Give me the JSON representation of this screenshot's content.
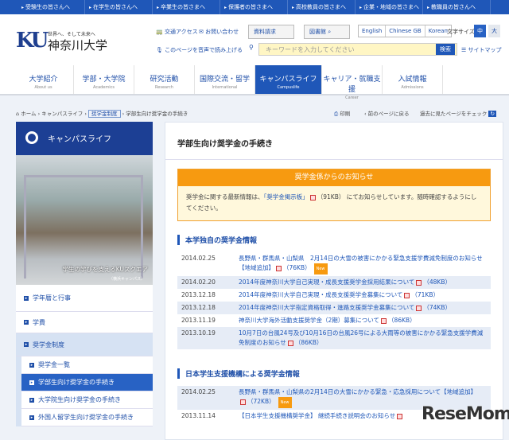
{
  "topbar": [
    "受験生の皆さんへ",
    "在学生の皆さんへ",
    "卒業生の皆さまへ",
    "保護者の皆さまへ",
    "高校教員の皆さまへ",
    "企業・地域の皆さまへ",
    "教職員の皆さんへ"
  ],
  "header": {
    "logo": "KU",
    "tagline": "世界へ、そして未来へ",
    "name": "神奈川大学",
    "access": "交通アクセス",
    "contact": "お問い合わせ",
    "request": "資料請求",
    "library": "図書館",
    "voice": "このページを音声で読み上げる",
    "langs": [
      "English",
      "Chinese GB",
      "Korean"
    ],
    "font_size_label": "文字サイズ",
    "font_mid": "中",
    "font_large": "大",
    "search_placeholder": "キーワードを入力してください",
    "search_button": "検索",
    "sitemap": "サイトマップ"
  },
  "nav": [
    {
      "jp": "大学紹介",
      "en": "About us"
    },
    {
      "jp": "学部・大学院",
      "en": "Academics"
    },
    {
      "jp": "研究活動",
      "en": "Research"
    },
    {
      "jp": "国際交流・留学",
      "en": "International"
    },
    {
      "jp": "キャンパスライフ",
      "en": "Campuslife"
    },
    {
      "jp": "キャリア・就職支援",
      "en": "Career"
    },
    {
      "jp": "入試情報",
      "en": "Admissions"
    }
  ],
  "breadcrumb": {
    "home": "ホーム",
    "b1": "キャンパスライフ",
    "b2": "奨学金制度",
    "current": "学部生向け奨学金の手続き"
  },
  "util": {
    "print": "印刷",
    "back": "前のページに戻る",
    "history": "過去に見たページをチェック"
  },
  "sidebar": {
    "title": "キャンパスライフ",
    "photo_caption": "学生の学びを支えるKUスクエア",
    "photo_sub": "（横浜キャンパス）",
    "items": [
      "学年暦と行事",
      "学費",
      "奨学金制度"
    ],
    "subitems": [
      "奨学金一覧",
      "学部生向け奨学金の手続き",
      "大学院生向け奨学金の手続き",
      "外国人留学生向け奨学金の手続き"
    ]
  },
  "main": {
    "title": "学部生向け奨学金の手続き",
    "notice": {
      "heading": "奨学金係からのお知らせ",
      "pre": "奨学金に関する最新情報は、",
      "link": "「奨学金掲示板」",
      "size": "（91KB）",
      "post": "にてお知らせしています。随時確認するようにしてください。"
    },
    "section1": "本学独自の奨学金情報",
    "rows1": [
      {
        "date": "2014.02.25",
        "text": "長野県・群馬県・山梨県　2月14日の大雪の被害にかかる緊急支援学費減免制度のお知らせ【地域追加】",
        "size": "（76KB）",
        "new": "New"
      },
      {
        "date": "2014.02.20",
        "text": "2014年度神奈川大学自己実現・成長支援奨学金採用結果について",
        "size": "（48KB）"
      },
      {
        "date": "2013.12.18",
        "text": "2014年度神奈川大学自己実現・成長支援奨学金募集について",
        "size": "（71KB）"
      },
      {
        "date": "2013.12.18",
        "text": "2014年度神奈川大学指定資格取得・進路支援奨学金募集について",
        "size": "（74KB）"
      },
      {
        "date": "2013.11.19",
        "text": "神奈川大学海外活動支援奨学金（2期）募集について",
        "size": "（86KB）"
      },
      {
        "date": "2013.10.19",
        "text": "10月7日の台風24号及び10月16日の台風26号による大雨等の被害にかかる緊急支援学費減免制度のお知らせ",
        "size": "（86KB）"
      }
    ],
    "section2": "日本学生支援機構による奨学金情報",
    "rows2": [
      {
        "date": "2014.02.25",
        "text": "長野県・群馬県・山梨県の2月14日の大雪にかかる緊急・応急採用について【地域追加】",
        "size": "（72KB）",
        "new": "New"
      },
      {
        "date": "2013.11.14",
        "text": "【日本学生支援機構奨学金】 継続手続き説明会のお知らせ",
        "size": ""
      }
    ]
  },
  "watermark": "ReseMom"
}
